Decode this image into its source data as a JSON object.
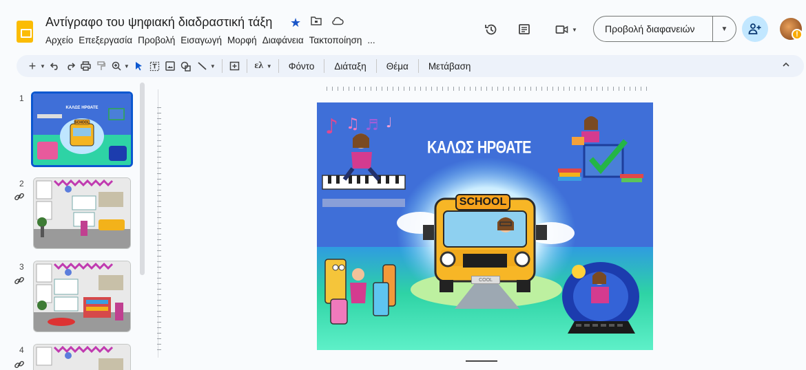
{
  "header": {
    "title": "Αντίγραφο του ψηφιακή διαδραστική τάξη",
    "menu": [
      "Αρχείο",
      "Επεξεργασία",
      "Προβολή",
      "Εισαγωγή",
      "Μορφή",
      "Διαφάνεια",
      "Τακτοποίηση",
      "..."
    ],
    "present_label": "Προβολή διαφανειών",
    "avatar_badge": "!"
  },
  "toolbar": {
    "input_tools_label": "ελ",
    "background_label": "Φόντο",
    "layout_label": "Διάταξη",
    "theme_label": "Θέμα",
    "transition_label": "Μετάβαση"
  },
  "filmstrip": {
    "slides": [
      {
        "number": "1",
        "linked": false
      },
      {
        "number": "2",
        "linked": true
      },
      {
        "number": "3",
        "linked": true
      },
      {
        "number": "4",
        "linked": true
      }
    ],
    "thumb1_title": "ΚΑΛΩΣ ΗΡΘΑΤΕ",
    "thumb1_sign": "SCHOOL"
  },
  "slide": {
    "title": "ΚΑΛΩΣ ΗΡΘΑΤΕ",
    "school_sign": "SCHOOL",
    "plate": "COOL"
  },
  "colors": {
    "accent": "#0b57d0",
    "logo": "#fbbc04",
    "toolbar_bg": "#edf2fa",
    "share_bg": "#c2e7ff",
    "slide_blue": "#3f6fd8",
    "slide_green": "#2ed3a5"
  }
}
